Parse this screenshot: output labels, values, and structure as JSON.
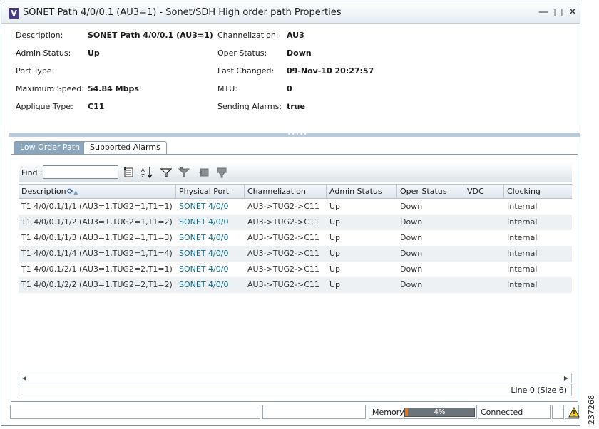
{
  "window": {
    "icon_letter": "V",
    "title": "SONET Path 4/0/0.1 (AU3=1) - Sonet/SDH High order path Properties",
    "minimize": "—",
    "maximize": "□",
    "close": "✕"
  },
  "properties": {
    "description_label": "Description:",
    "description_value": "SONET Path 4/0/0.1 (AU3=1)",
    "admin_status_label": "Admin Status:",
    "admin_status_value": "Up",
    "port_type_label": "Port Type:",
    "port_type_value": "",
    "max_speed_label": "Maximum Speed:",
    "max_speed_value": "54.84 Mbps",
    "applique_label": "Applique Type:",
    "applique_value": "C11",
    "channelization_label": "Channelization:",
    "channelization_value": "AU3",
    "oper_status_label": "Oper Status:",
    "oper_status_value": "Down",
    "last_changed_label": "Last Changed:",
    "last_changed_value": "09-Nov-10 20:27:57",
    "mtu_label": "MTU:",
    "mtu_value": "0",
    "sending_alarms_label": "Sending Alarms:",
    "sending_alarms_value": "true"
  },
  "splitter_grip": "•••••",
  "tabs": [
    {
      "label": "Low Order Path",
      "active": true
    },
    {
      "label": "Supported Alarms",
      "active": false
    }
  ],
  "toolbar": {
    "find_label": "Find :",
    "find_value": "",
    "icons": [
      "export-icon",
      "sort-icon",
      "filter-icon",
      "quick-filter-icon",
      "clear-filter-icon",
      "advanced-filter-icon"
    ]
  },
  "table": {
    "columns": [
      "Description",
      "Physical Port",
      "Channelization",
      "Admin Status",
      "Oper Status",
      "VDC",
      "Clocking"
    ],
    "rows": [
      [
        "T1 4/0/0.1/1/1 (AU3=1,TUG2=1,T1=1)",
        "SONET 4/0/0",
        "AU3->TUG2->C11",
        "Up",
        "Down",
        "",
        "Internal"
      ],
      [
        "T1 4/0/0.1/1/2 (AU3=1,TUG2=1,T1=2)",
        "SONET 4/0/0",
        "AU3->TUG2->C11",
        "Up",
        "Down",
        "",
        "Internal"
      ],
      [
        "T1 4/0/0.1/1/3 (AU3=1,TUG2=1,T1=3)",
        "SONET 4/0/0",
        "AU3->TUG2->C11",
        "Up",
        "Down",
        "",
        "Internal"
      ],
      [
        "T1 4/0/0.1/1/4 (AU3=1,TUG2=1,T1=4)",
        "SONET 4/0/0",
        "AU3->TUG2->C11",
        "Up",
        "Down",
        "",
        "Internal"
      ],
      [
        "T1 4/0/0.1/2/1 (AU3=1,TUG2=2,T1=1)",
        "SONET 4/0/0",
        "AU3->TUG2->C11",
        "Up",
        "Down",
        "",
        "Internal"
      ],
      [
        "T1 4/0/0.1/2/2 (AU3=1,TUG2=2,T1=2)",
        "SONET 4/0/0",
        "AU3->TUG2->C11",
        "Up",
        "Down",
        "",
        "Internal"
      ]
    ],
    "line_count": "Line 0 (Size 6)"
  },
  "status_bar": {
    "memory_label": "Memory:",
    "memory_percent": 4,
    "memory_text": "4%",
    "connection": "Connected",
    "warning_icon": "warning-icon"
  },
  "figure_id": "237268"
}
